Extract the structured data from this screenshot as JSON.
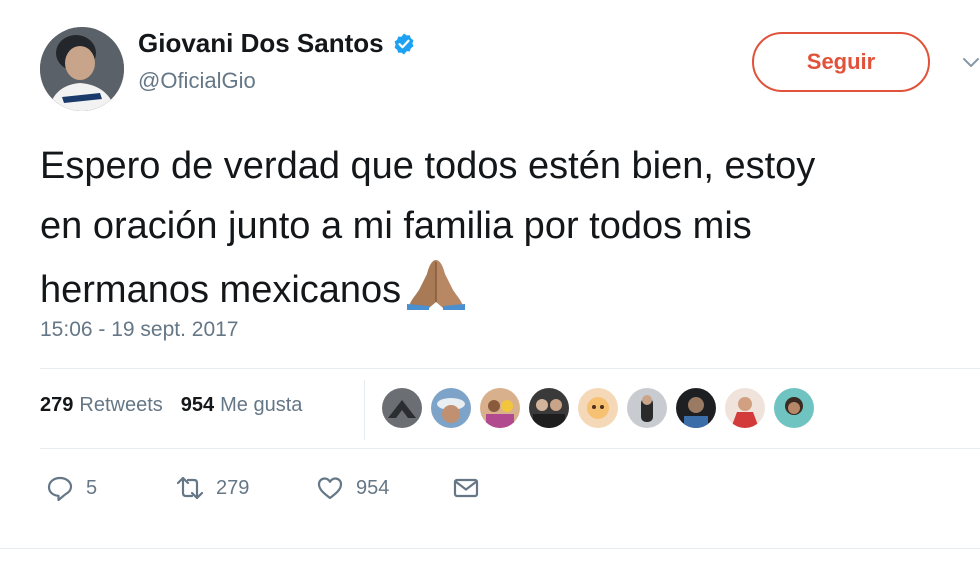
{
  "user": {
    "name": "Giovani Dos Santos",
    "handle": "@OficialGio"
  },
  "follow_button": {
    "label": "Seguir"
  },
  "tweet": {
    "lines": [
      "Espero de verdad que todos estén bien, estoy",
      "en oración junto a mi familia por todos mis",
      "hermanos mexicanos"
    ],
    "emoji": "folded-hands-icon",
    "timestamp": "15:06 - 19 sept. 2017"
  },
  "stats": {
    "retweets_count": "279",
    "retweets_label": "Retweets",
    "likes_count": "954",
    "likes_label": "Me gusta"
  },
  "actions": {
    "reply_count": "5",
    "retweet_count": "279",
    "like_count": "954"
  },
  "colors": {
    "accent": "#e0533a",
    "verified": "#1da1f2",
    "muted": "#657786",
    "text": "#14171a"
  }
}
